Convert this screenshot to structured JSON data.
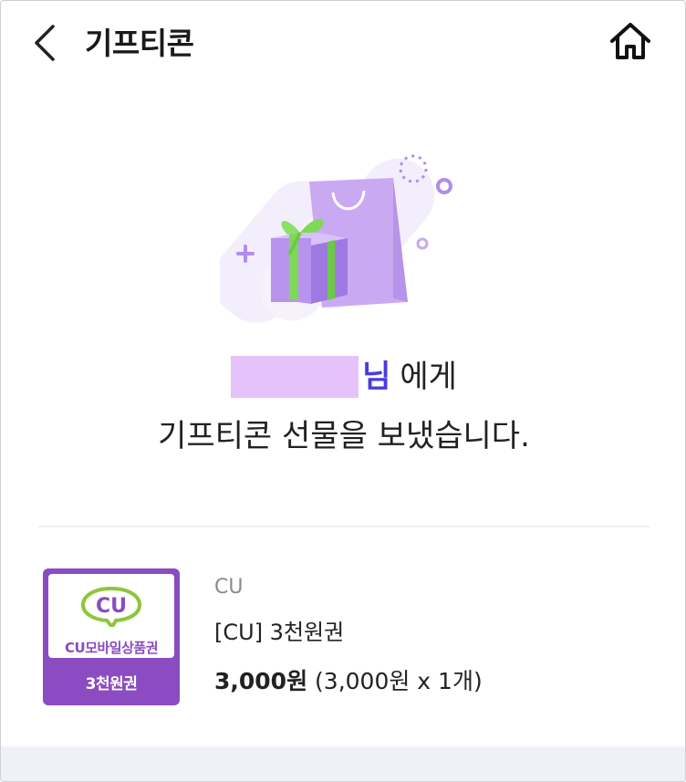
{
  "header": {
    "title": "기프티콘",
    "back_icon": "chevron-left-icon",
    "home_icon": "home-icon"
  },
  "message": {
    "recipient_suffix": "님",
    "line1_tail": "에게",
    "line2": "기프티콘 선물을 보냈습니다."
  },
  "product": {
    "brand": "CU",
    "name": "[CU] 3천원권",
    "price": "3,000원",
    "price_detail": "(3,000원 x 1개)",
    "card": {
      "logo_text": "CU",
      "brand_label": "CU모바일상품권",
      "amount_label": "3천원권"
    }
  },
  "colors": {
    "accent": "#4a3be0",
    "masked_name": "#e6c2fb",
    "card_purple": "#8a4cc0",
    "cu_green": "#8cc63f"
  }
}
